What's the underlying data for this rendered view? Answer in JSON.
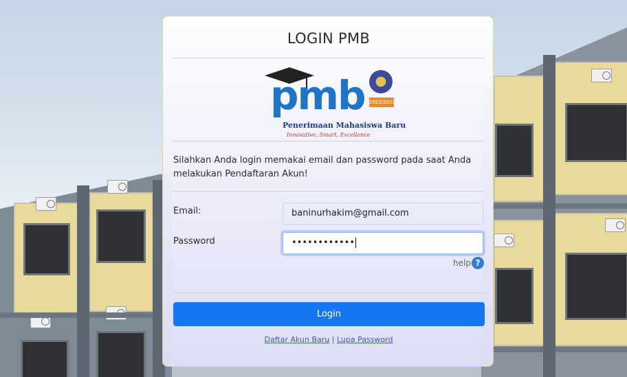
{
  "login": {
    "title": "LOGIN PMB",
    "logo": {
      "wordmark": "pmb",
      "subtitle": "Penerimaan Mahasiswa Baru",
      "tagline": "Innovative, Smart, Excellence",
      "year": "2022/2023"
    },
    "instruction": "Silahkan Anda login memakai email dan password pada saat Anda melakukan Pendaftaran Akun!",
    "email_label": "Email:",
    "email_value": "baninurhakim@gmail.com",
    "password_label": "Password",
    "password_value": "••••••••••••",
    "help_label": "help",
    "help_icon": "?",
    "login_button": "Login",
    "link_register": "Daftar Akun Baru",
    "link_separator": "|",
    "link_forgot": "Lupa Password"
  },
  "colors": {
    "primary_button": "#1677f5",
    "link": "#3b5bbf",
    "card_border": "#d8dc8a"
  }
}
